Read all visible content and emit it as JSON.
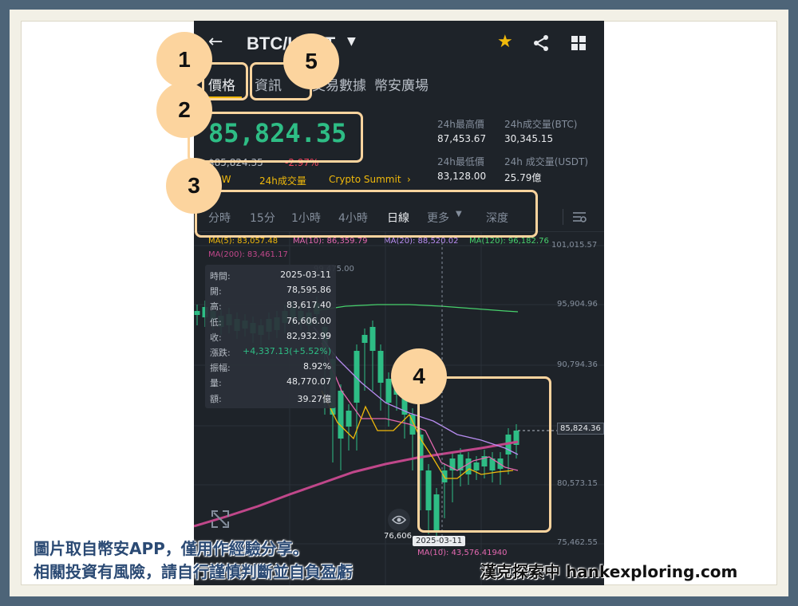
{
  "header": {
    "title": "BTC/USDT"
  },
  "tabs": [
    {
      "label": "價格"
    },
    {
      "label": "資訊"
    },
    {
      "label": "交易數據"
    },
    {
      "label": "幣安廣場"
    }
  ],
  "price": {
    "last": "85,824.35",
    "fiat": "$85,824.35",
    "change": "-2.97%",
    "tags": [
      "POW",
      "24h成交量",
      "Crypto Summit"
    ]
  },
  "stats": [
    {
      "label": "24h最高價",
      "value": "87,453.67"
    },
    {
      "label": "24h成交量(BTC)",
      "value": "30,345.15"
    },
    {
      "label": "24h最低價",
      "value": "83,128.00"
    },
    {
      "label": "24h 成交量(USDT)",
      "value": "25.79億"
    }
  ],
  "intervals": [
    "分時",
    "15分",
    "1小時",
    "4小時",
    "日線",
    "更多",
    "深度"
  ],
  "ma": {
    "ma5": "MA(5): 83,057.48",
    "ma10": "MA(10): 86,359.79",
    "ma20": "MA(20): 88,520.02",
    "ma120": "MA(120): 96,182.76",
    "ma200": "MA(200): 83,461.17",
    "vol_ma": "MA(10): 43,576.41940"
  },
  "tooltip": [
    {
      "label": "時間:",
      "value": "2025-03-11"
    },
    {
      "label": "開:",
      "value": "78,595.86"
    },
    {
      "label": "高:",
      "value": "83,617.40"
    },
    {
      "label": "低:",
      "value": "76,606.00"
    },
    {
      "label": "收:",
      "value": "82,932.99"
    },
    {
      "label": "漲跌:",
      "value": "+4,337.13(+5.52%)"
    },
    {
      "label": "振幅:",
      "value": "8.92%"
    },
    {
      "label": "量:",
      "value": "48,770.07"
    },
    {
      "label": "額:",
      "value": "39.27億"
    }
  ],
  "axis": {
    "y_labels": [
      "101,015.57",
      "95,904.96",
      "90,794.36",
      "85,824.36",
      "80,573.15",
      "75,462.55"
    ],
    "x_marker": "2025-03-11",
    "low_marker": "76,606",
    "high_marker": "99,475.00"
  },
  "badges": [
    "1",
    "2",
    "3",
    "4",
    "5"
  ],
  "caption": {
    "line1": "圖片取自幣安APP，僅用作經驗分享。",
    "line2": "相關投資有風險，請自行謹慎判斷並自負盈虧",
    "brand": "漢克探索中 hankexploring.com"
  },
  "colors": {
    "up": "#2ebd85",
    "down": "#f6465d",
    "accent": "#f0b90b",
    "badge": "#fcd49e"
  }
}
